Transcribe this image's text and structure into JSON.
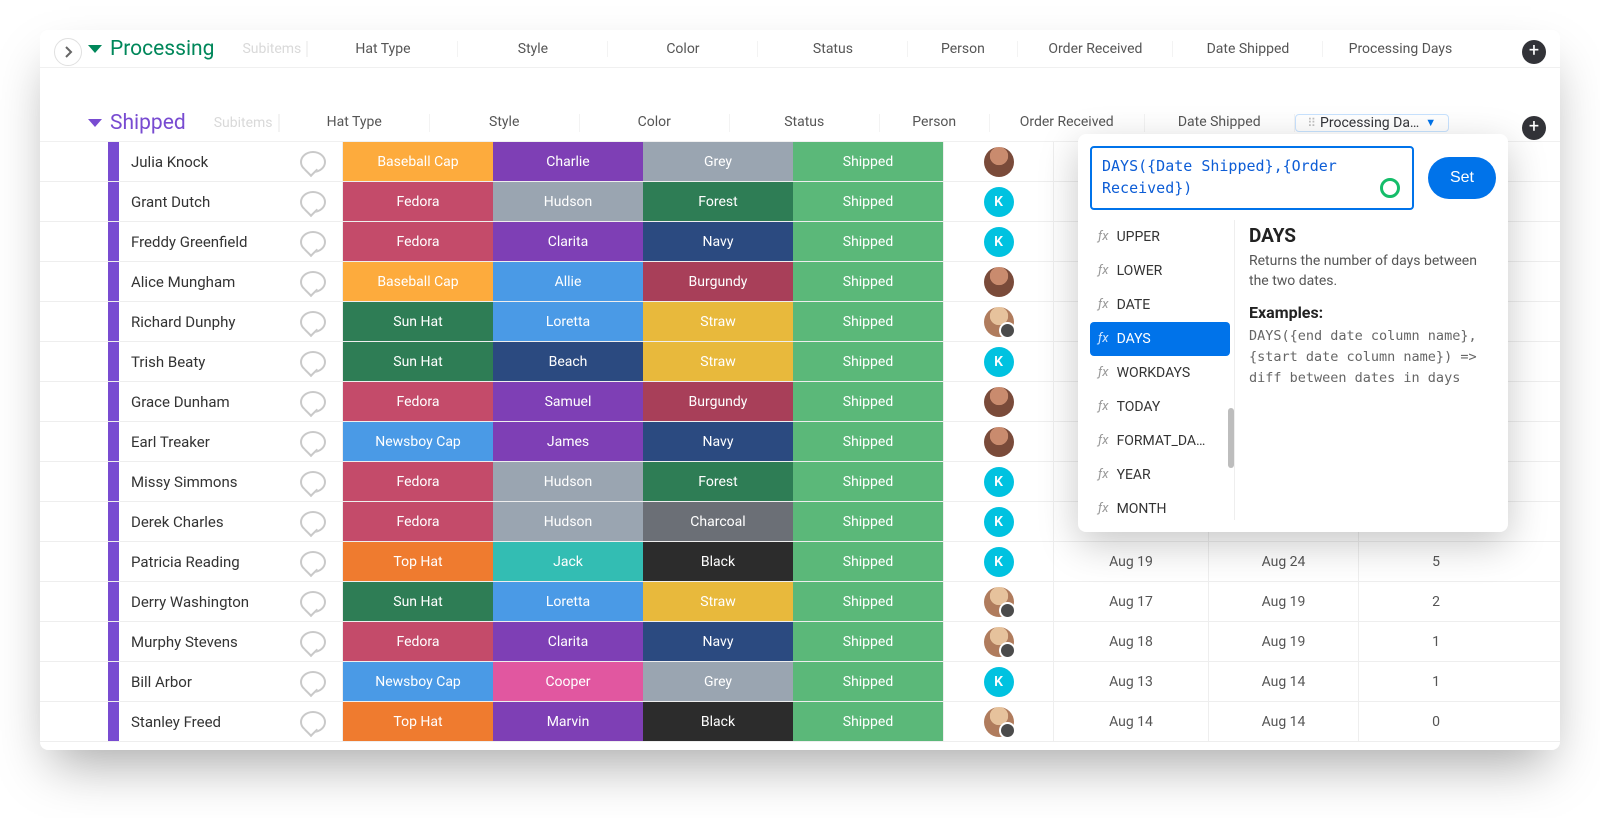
{
  "groups": {
    "processing": {
      "title": "Processing",
      "subitems_placeholder": "Subitems"
    },
    "shipped": {
      "title": "Shipped",
      "subitems_placeholder": "Subitems"
    }
  },
  "columns": {
    "hat": "Hat Type",
    "style": "Style",
    "color": "Color",
    "status": "Status",
    "person": "Person",
    "order": "Order Received",
    "date": "Date Shipped",
    "proc": "Processing Days",
    "proc_short": "Processing Da…"
  },
  "colors": {
    "yellow": "#fdab3d",
    "red": "#c44b6a",
    "green": "#2e7d55",
    "purple": "#7e3fb5",
    "blue": "#3b82d6",
    "grey": "#9aa5b1",
    "navy": "#2b4a80",
    "burgundy": "#a83f59",
    "orange": "#ef7b2f",
    "teal": "#33bdb3",
    "pink": "#e157a0",
    "charcoal": "#6b6f76",
    "black": "#2c2c2c",
    "status_green": "#5bb879",
    "forest": "#2e7d55",
    "straw": "#e8b93c",
    "lightblue": "#4a9ae6",
    "hudson": "#9aa5b1",
    "greycell": "#9aa5b1"
  },
  "rows": [
    {
      "name": "Julia Knock",
      "hat": "Baseball Cap",
      "hat_c": "yellow",
      "style": "Charlie",
      "style_c": "purple",
      "color": "Grey",
      "color_c": "greycell",
      "person": "img1",
      "order": "",
      "date": "",
      "proc": ""
    },
    {
      "name": "Grant Dutch",
      "hat": "Fedora",
      "hat_c": "red",
      "style": "Hudson",
      "style_c": "hudson",
      "color": "Forest",
      "color_c": "forest",
      "person": "k",
      "order": "",
      "date": "",
      "proc": ""
    },
    {
      "name": "Freddy Greenfield",
      "hat": "Fedora",
      "hat_c": "red",
      "style": "Clarita",
      "style_c": "purple",
      "color": "Navy",
      "color_c": "navy",
      "person": "k",
      "order": "",
      "date": "",
      "proc": ""
    },
    {
      "name": "Alice Mungham",
      "hat": "Baseball Cap",
      "hat_c": "yellow",
      "style": "Allie",
      "style_c": "lightblue",
      "color": "Burgundy",
      "color_c": "burgundy",
      "person": "img1",
      "order": "",
      "date": "",
      "proc": ""
    },
    {
      "name": "Richard Dunphy",
      "hat": "Sun Hat",
      "hat_c": "green",
      "style": "Loretta",
      "style_c": "lightblue",
      "color": "Straw",
      "color_c": "straw",
      "person": "img2_home",
      "order": "",
      "date": "",
      "proc": ""
    },
    {
      "name": "Trish Beaty",
      "hat": "Sun Hat",
      "hat_c": "green",
      "style": "Beach",
      "style_c": "navy",
      "color": "Straw",
      "color_c": "straw",
      "person": "k",
      "order": "",
      "date": "",
      "proc": ""
    },
    {
      "name": "Grace Dunham",
      "hat": "Fedora",
      "hat_c": "red",
      "style": "Samuel",
      "style_c": "purple",
      "color": "Burgundy",
      "color_c": "burgundy",
      "person": "img1",
      "order": "",
      "date": "",
      "proc": ""
    },
    {
      "name": "Earl Treaker",
      "hat": "Newsboy Cap",
      "hat_c": "lightblue",
      "style": "James",
      "style_c": "purple",
      "color": "Navy",
      "color_c": "navy",
      "person": "img1",
      "order": "",
      "date": "",
      "proc": ""
    },
    {
      "name": "Missy Simmons",
      "hat": "Fedora",
      "hat_c": "red",
      "style": "Hudson",
      "style_c": "hudson",
      "color": "Forest",
      "color_c": "forest",
      "person": "k",
      "order": "",
      "date": "",
      "proc": ""
    },
    {
      "name": "Derek Charles",
      "hat": "Fedora",
      "hat_c": "red",
      "style": "Hudson",
      "style_c": "hudson",
      "color": "Charcoal",
      "color_c": "charcoal",
      "person": "k",
      "order": "",
      "date": "",
      "proc": ""
    },
    {
      "name": "Patricia Reading",
      "hat": "Top Hat",
      "hat_c": "orange",
      "style": "Jack",
      "style_c": "teal",
      "color": "Black",
      "color_c": "black",
      "person": "k",
      "order": "Aug 19",
      "date": "Aug 24",
      "proc": "5"
    },
    {
      "name": "Derry Washington",
      "hat": "Sun Hat",
      "hat_c": "green",
      "style": "Loretta",
      "style_c": "lightblue",
      "color": "Straw",
      "color_c": "straw",
      "person": "img2_home",
      "order": "Aug 17",
      "date": "Aug 19",
      "proc": "2"
    },
    {
      "name": "Murphy Stevens",
      "hat": "Fedora",
      "hat_c": "red",
      "style": "Clarita",
      "style_c": "purple",
      "color": "Navy",
      "color_c": "navy",
      "person": "img2_home",
      "order": "Aug 18",
      "date": "Aug 19",
      "proc": "1"
    },
    {
      "name": "Bill Arbor",
      "hat": "Newsboy Cap",
      "hat_c": "lightblue",
      "style": "Cooper",
      "style_c": "pink",
      "color": "Grey",
      "color_c": "greycell",
      "person": "k",
      "order": "Aug 13",
      "date": "Aug 14",
      "proc": "1"
    },
    {
      "name": "Stanley Freed",
      "hat": "Top Hat",
      "hat_c": "orange",
      "style": "Marvin",
      "style_c": "purple",
      "color": "Black",
      "color_c": "black",
      "person": "img2_home",
      "order": "Aug 14",
      "date": "Aug 14",
      "proc": "0"
    }
  ],
  "status_text": "Shipped",
  "avatar_k_letter": "K",
  "formula": {
    "text": "DAYS({Date Shipped},{Order Received})",
    "set_label": "Set",
    "functions": [
      "UPPER",
      "LOWER",
      "DATE",
      "DAYS",
      "WORKDAYS",
      "TODAY",
      "FORMAT_DA…",
      "YEAR",
      "MONTH"
    ],
    "selected": "DAYS",
    "doc_title": "DAYS",
    "doc_desc": "Returns the number of days between the two dates.",
    "examples_title": "Examples:",
    "example_code": "DAYS({end date column name},{start date column name}) => diff between dates in days"
  }
}
